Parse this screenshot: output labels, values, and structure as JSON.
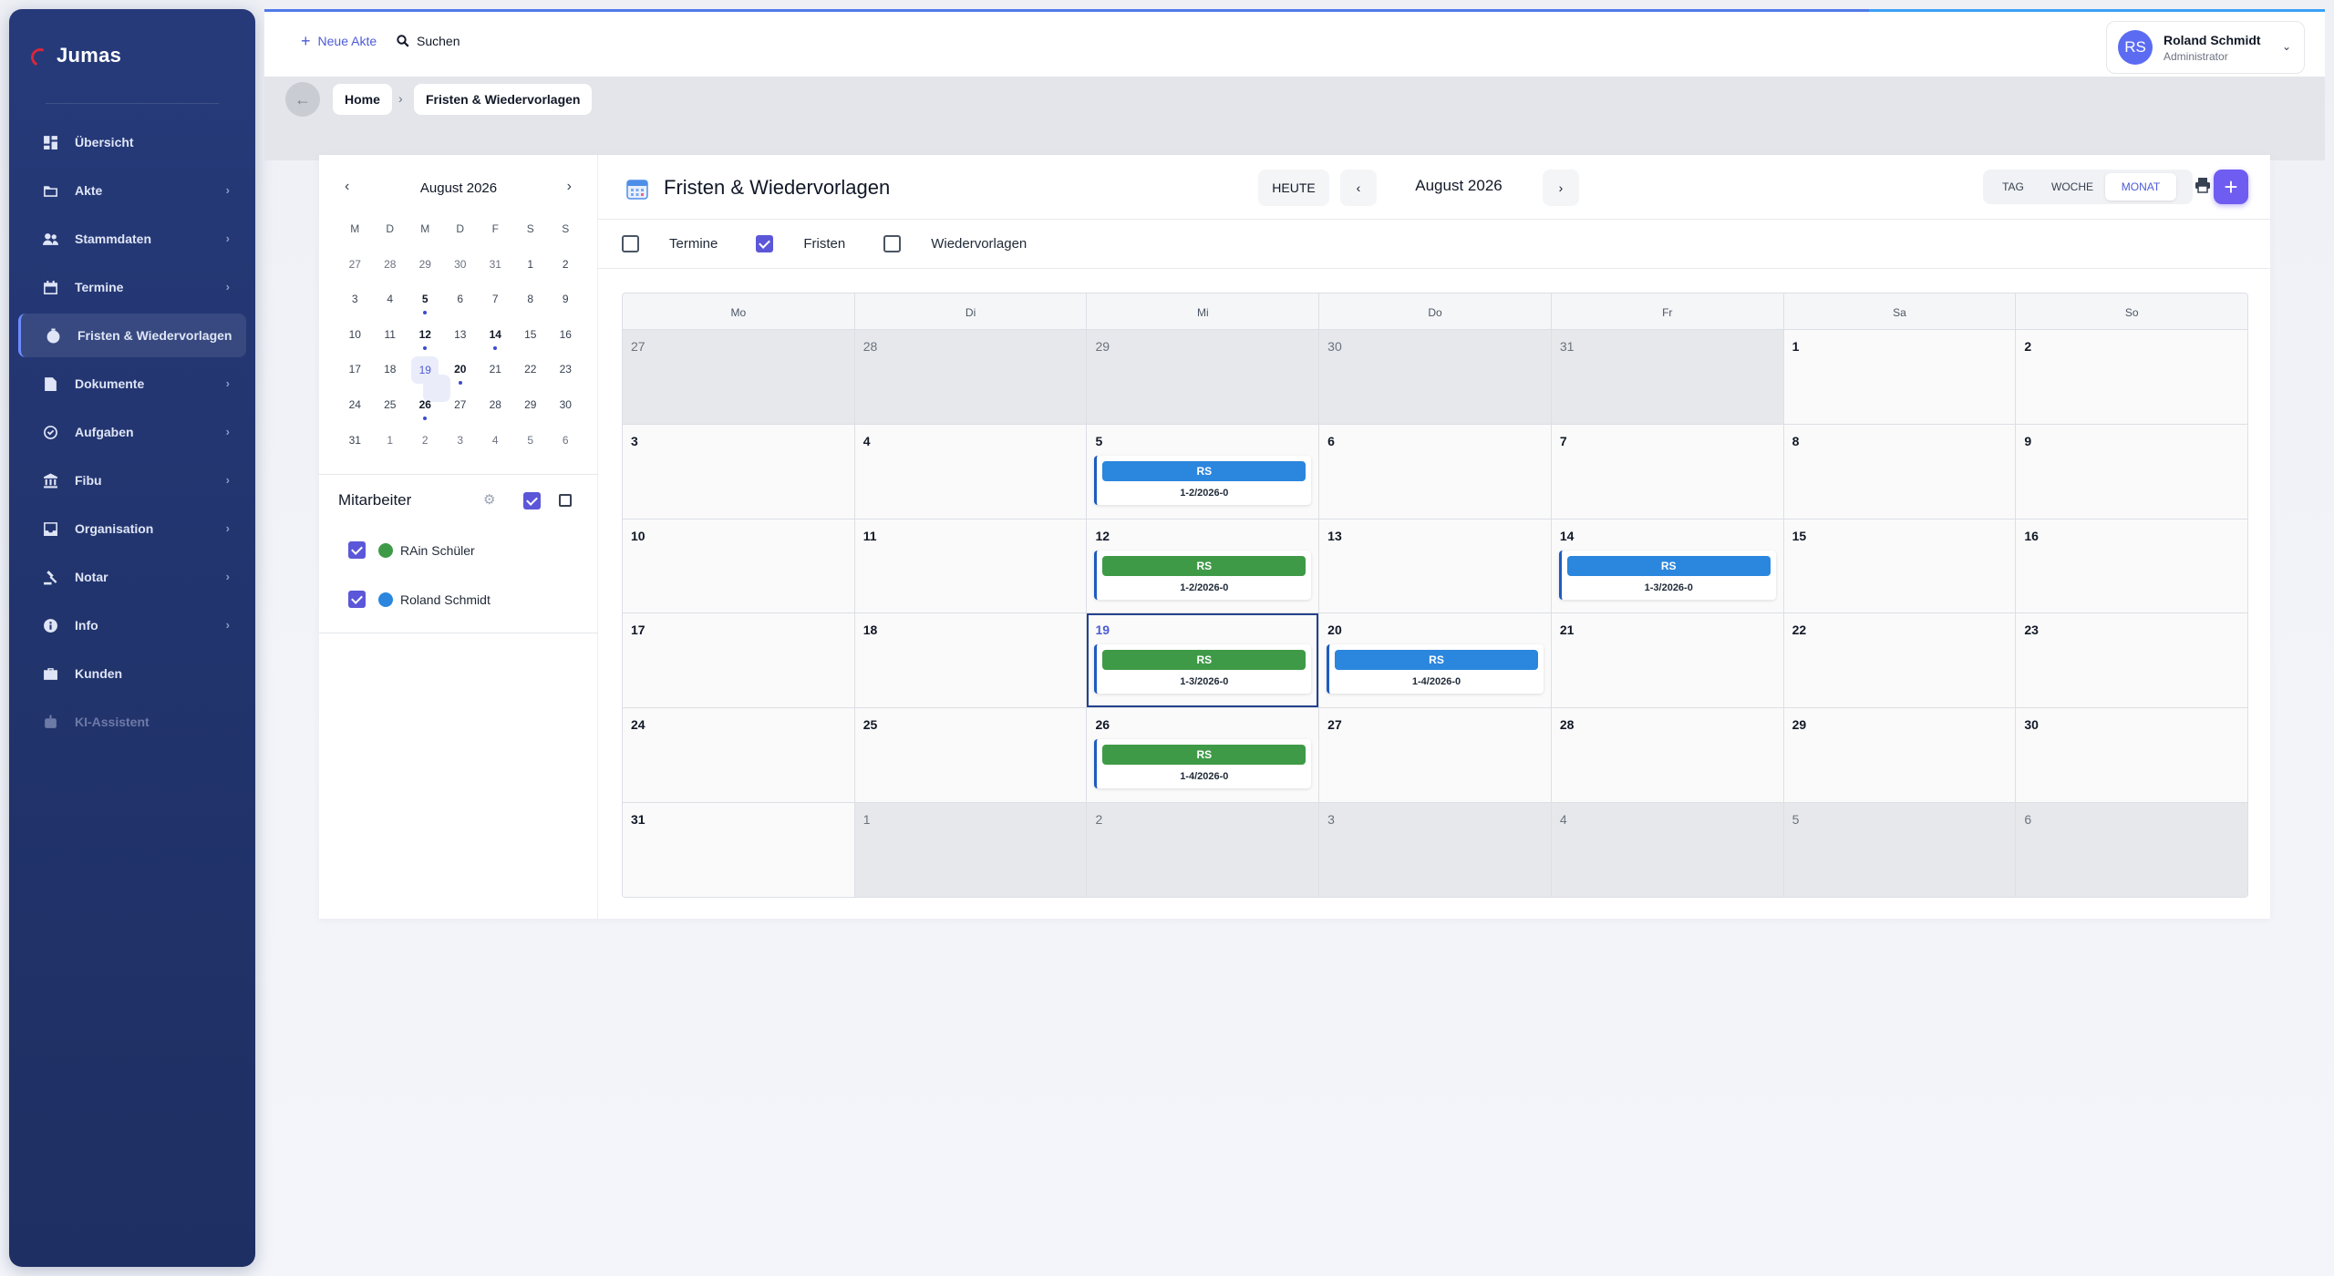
{
  "app": {
    "name": "Jumas"
  },
  "sidebar": {
    "items": [
      {
        "label": "Übersicht",
        "icon": "dashboard-icon",
        "chevron": false,
        "active": false,
        "disabled": false
      },
      {
        "label": "Akte",
        "icon": "folder-icon",
        "chevron": true,
        "active": false,
        "disabled": false
      },
      {
        "label": "Stammdaten",
        "icon": "people-icon",
        "chevron": true,
        "active": false,
        "disabled": false
      },
      {
        "label": "Termine",
        "icon": "calendar-icon",
        "chevron": true,
        "active": false,
        "disabled": false
      },
      {
        "label": "Fristen & Wiedervorlagen",
        "icon": "timer-icon",
        "chevron": false,
        "active": true,
        "disabled": false
      },
      {
        "label": "Dokumente",
        "icon": "document-icon",
        "chevron": true,
        "active": false,
        "disabled": false
      },
      {
        "label": "Aufgaben",
        "icon": "check-circle-icon",
        "chevron": true,
        "active": false,
        "disabled": false
      },
      {
        "label": "Fibu",
        "icon": "bank-icon",
        "chevron": true,
        "active": false,
        "disabled": false
      },
      {
        "label": "Organisation",
        "icon": "inbox-icon",
        "chevron": true,
        "active": false,
        "disabled": false
      },
      {
        "label": "Notar",
        "icon": "gavel-icon",
        "chevron": true,
        "active": false,
        "disabled": false
      },
      {
        "label": "Info",
        "icon": "info-icon",
        "chevron": true,
        "active": false,
        "disabled": false
      },
      {
        "label": "Kunden",
        "icon": "briefcase-icon",
        "chevron": false,
        "active": false,
        "disabled": false
      },
      {
        "label": "KI-Assistent",
        "icon": "robot-icon",
        "chevron": false,
        "active": false,
        "disabled": true
      }
    ]
  },
  "topbar": {
    "new_label": "Neue Akte",
    "search_label": "Suchen",
    "user": {
      "initials": "RS",
      "name": "Roland Schmidt",
      "role": "Administrator"
    }
  },
  "breadcrumb": {
    "home": "Home",
    "current": "Fristen & Wiedervorlagen",
    "separator": "›"
  },
  "mini_calendar": {
    "month_label": "August 2026",
    "prev": "‹",
    "next": "›",
    "weekdays": [
      "M",
      "D",
      "M",
      "D",
      "F",
      "S",
      "S"
    ],
    "weeks": [
      [
        {
          "d": "27",
          "o": true
        },
        {
          "d": "28",
          "o": true
        },
        {
          "d": "29",
          "o": true
        },
        {
          "d": "30",
          "o": true
        },
        {
          "d": "31",
          "o": true
        },
        {
          "d": "1"
        },
        {
          "d": "2"
        }
      ],
      [
        {
          "d": "3"
        },
        {
          "d": "4"
        },
        {
          "d": "5",
          "b": true,
          "dot": true
        },
        {
          "d": "6"
        },
        {
          "d": "7"
        },
        {
          "d": "8"
        },
        {
          "d": "9"
        }
      ],
      [
        {
          "d": "10"
        },
        {
          "d": "11"
        },
        {
          "d": "12",
          "b": true,
          "dot": true
        },
        {
          "d": "13"
        },
        {
          "d": "14",
          "b": true,
          "dot": true
        },
        {
          "d": "15"
        },
        {
          "d": "16"
        }
      ],
      [
        {
          "d": "17"
        },
        {
          "d": "18"
        },
        {
          "d": "19",
          "today": true,
          "dot": true
        },
        {
          "d": "20",
          "b": true,
          "dot": true
        },
        {
          "d": "21"
        },
        {
          "d": "22"
        },
        {
          "d": "23"
        }
      ],
      [
        {
          "d": "24"
        },
        {
          "d": "25"
        },
        {
          "d": "26",
          "b": true,
          "dot": true
        },
        {
          "d": "27"
        },
        {
          "d": "28"
        },
        {
          "d": "29"
        },
        {
          "d": "30"
        }
      ],
      [
        {
          "d": "31"
        },
        {
          "d": "1",
          "o": true
        },
        {
          "d": "2",
          "o": true
        },
        {
          "d": "3",
          "o": true
        },
        {
          "d": "4",
          "o": true
        },
        {
          "d": "5",
          "o": true
        },
        {
          "d": "6",
          "o": true
        }
      ]
    ]
  },
  "mitarbeiter": {
    "title": "Mitarbeiter",
    "people": [
      {
        "name": "RAin Schüler",
        "color": "#3f9a47",
        "checked": true
      },
      {
        "name": "Roland Schmidt",
        "color": "#2b86dd",
        "checked": true
      }
    ]
  },
  "calendar": {
    "title": "Fristen & Wiedervorlagen",
    "today_label": "HEUTE",
    "prev": "‹",
    "next": "›",
    "month_label": "August 2026",
    "views": [
      {
        "label": "TAG",
        "active": false
      },
      {
        "label": "WOCHE",
        "active": false
      },
      {
        "label": "MONAT",
        "active": true
      }
    ],
    "add_label": "+",
    "filters": [
      {
        "label": "Termine",
        "checked": false
      },
      {
        "label": "Fristen",
        "checked": true
      },
      {
        "label": "Wiedervorlagen",
        "checked": false
      }
    ],
    "weekdays": [
      "Mo",
      "Di",
      "Mi",
      "Do",
      "Fr",
      "Sa",
      "So"
    ],
    "weeks": [
      [
        {
          "d": "27",
          "o": true
        },
        {
          "d": "28",
          "o": true
        },
        {
          "d": "29",
          "o": true
        },
        {
          "d": "30",
          "o": true
        },
        {
          "d": "31",
          "o": true
        },
        {
          "d": "1"
        },
        {
          "d": "2"
        }
      ],
      [
        {
          "d": "3"
        },
        {
          "d": "4"
        },
        {
          "d": "5",
          "event": {
            "label": "RS",
            "ref": "1-2/2026-0",
            "color": "#2b86dd"
          }
        },
        {
          "d": "6"
        },
        {
          "d": "7"
        },
        {
          "d": "8"
        },
        {
          "d": "9"
        }
      ],
      [
        {
          "d": "10"
        },
        {
          "d": "11"
        },
        {
          "d": "12",
          "event": {
            "label": "RS",
            "ref": "1-2/2026-0",
            "color": "#3f9a47"
          }
        },
        {
          "d": "13"
        },
        {
          "d": "14",
          "event": {
            "label": "RS",
            "ref": "1-3/2026-0",
            "color": "#2b86dd"
          }
        },
        {
          "d": "15"
        },
        {
          "d": "16"
        }
      ],
      [
        {
          "d": "17"
        },
        {
          "d": "18"
        },
        {
          "d": "19",
          "today": true,
          "event": {
            "label": "RS",
            "ref": "1-3/2026-0",
            "color": "#3f9a47"
          }
        },
        {
          "d": "20",
          "event": {
            "label": "RS",
            "ref": "1-4/2026-0",
            "color": "#2b86dd"
          }
        },
        {
          "d": "21"
        },
        {
          "d": "22"
        },
        {
          "d": "23"
        }
      ],
      [
        {
          "d": "24"
        },
        {
          "d": "25"
        },
        {
          "d": "26",
          "event": {
            "label": "RS",
            "ref": "1-4/2026-0",
            "color": "#3f9a47"
          }
        },
        {
          "d": "27"
        },
        {
          "d": "28"
        },
        {
          "d": "29"
        },
        {
          "d": "30"
        }
      ],
      [
        {
          "d": "31"
        },
        {
          "d": "1",
          "o": true
        },
        {
          "d": "2",
          "o": true
        },
        {
          "d": "3",
          "o": true
        },
        {
          "d": "4",
          "o": true
        },
        {
          "d": "5",
          "o": true
        },
        {
          "d": "6",
          "o": true
        }
      ]
    ]
  }
}
